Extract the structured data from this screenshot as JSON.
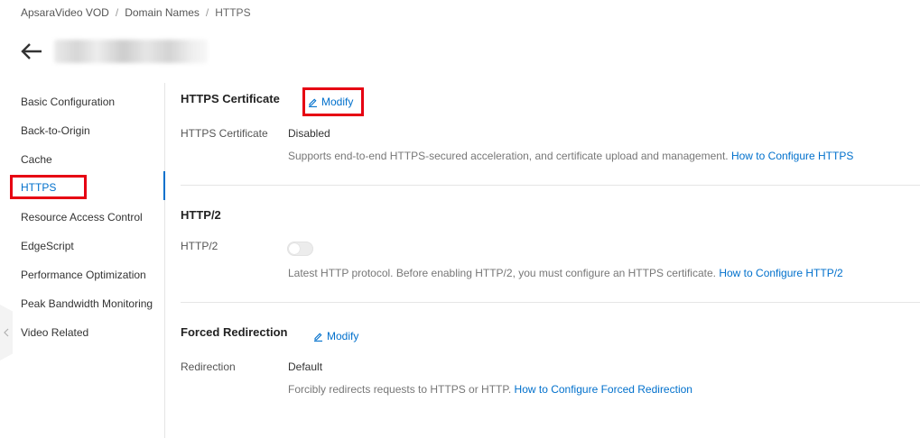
{
  "breadcrumb": {
    "items": [
      "ApsaraVideo VOD",
      "Domain Names",
      "HTTPS"
    ],
    "separator": "/"
  },
  "header": {
    "back_icon": "arrow-left-icon"
  },
  "sidebar": {
    "items": [
      {
        "label": "Basic Configuration"
      },
      {
        "label": "Back-to-Origin"
      },
      {
        "label": "Cache"
      },
      {
        "label": "HTTPS",
        "active": true
      },
      {
        "label": "Resource Access Control"
      },
      {
        "label": "EdgeScript"
      },
      {
        "label": "Performance Optimization"
      },
      {
        "label": "Peak Bandwidth Monitoring"
      },
      {
        "label": "Video Related"
      }
    ],
    "accent_color": "#0070cc"
  },
  "sections": {
    "https_certificate": {
      "title": "HTTPS Certificate",
      "modify_label": "Modify",
      "field_label": "HTTPS Certificate",
      "field_value": "Disabled",
      "description": "Supports end-to-end HTTPS-secured acceleration, and certificate upload and management.",
      "help_link": "How to Configure HTTPS"
    },
    "http2": {
      "title": "HTTP/2",
      "field_label": "HTTP/2",
      "toggle_on": false,
      "description": "Latest HTTP protocol. Before enabling HTTP/2, you must configure an HTTPS certificate.",
      "help_link": "How to Configure HTTP/2"
    },
    "forced_redirection": {
      "title": "Forced Redirection",
      "modify_label": "Modify",
      "field_label": "Redirection",
      "field_value": "Default",
      "description": "Forcibly redirects requests to HTTPS or HTTP.",
      "help_link": "How to Configure Forced Redirection"
    }
  },
  "colors": {
    "link": "#0070cc",
    "highlight_box": "#e60012"
  }
}
